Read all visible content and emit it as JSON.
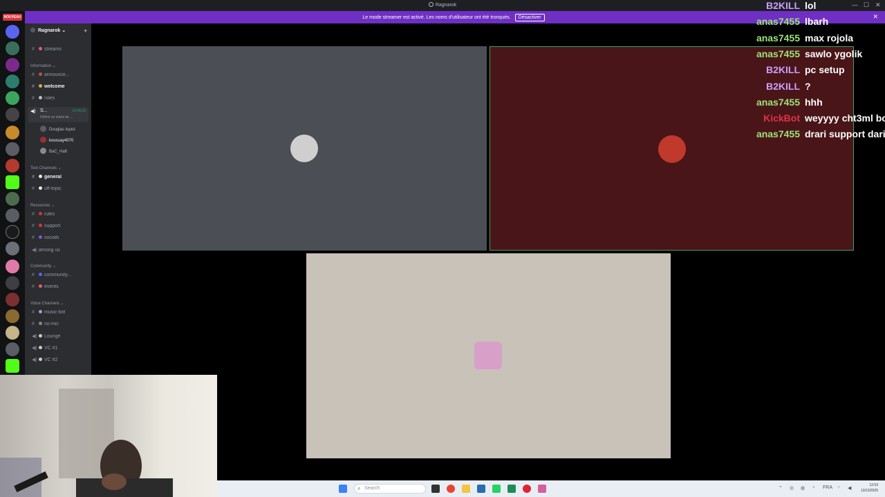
{
  "window": {
    "title": "Ragnarok",
    "controls": {
      "minimize": "—",
      "maximize": "☐",
      "close": "✕"
    }
  },
  "notice": {
    "message": "Le mode streamer est activé. Les noms d'utilisateur ont été tronqués.",
    "button": "Désactiver",
    "close": "✕"
  },
  "rail": {
    "badge": "NOUVEAU"
  },
  "server": {
    "name": "Ragnarok",
    "chevron": "⌄",
    "add_friend": "+"
  },
  "channels": {
    "streams": "streams",
    "cat_information": "Information ⌄",
    "announcements": "announce...",
    "welcome": "welcome",
    "roles": "roles",
    "live_channel": "S...",
    "live_time": "13:45:59",
    "live_sub": "Définir un statut de ...",
    "voice_users": [
      "Douglas lopez",
      "koussay4070",
      "BaC_Haft"
    ],
    "cat_text": "Text Channels ⌄",
    "general": "general",
    "off_topic": "off-topic",
    "cat_resources": "Resources ⌄",
    "rules": "rules",
    "support": "support",
    "socials": "socials",
    "among_us": "among us",
    "cat_community": "Community ⌄",
    "community": "community...",
    "events": "events",
    "cat_voice": "Voice Channels ⌄",
    "music_bot": "music-bot",
    "no_mic": "no-mic",
    "lounge": "Lounge",
    "vc1": "VC #1",
    "vc2": "VC #2"
  },
  "tiles": [
    {
      "bg": "#4b4e55",
      "avatar": "#cfcfcf"
    },
    {
      "bg": "#4a1518",
      "avatar": "#c0392b",
      "speaking_border": "#3ba55c"
    },
    {
      "bg": "#c8c2b8",
      "avatar": "#d8a0c8"
    }
  ],
  "chat": [
    {
      "user": "B2KILL",
      "text": "lol",
      "color": "#c9a0ff"
    },
    {
      "user": "anas7455",
      "text": "lbarh",
      "color": "#9be37a"
    },
    {
      "user": "anas7455",
      "text": "max rojola",
      "color": "#9be37a"
    },
    {
      "user": "anas7455",
      "text": "sawlo ygolik",
      "color": "#9be37a"
    },
    {
      "user": "B2KILL",
      "text": "pc setup",
      "color": "#c9a0ff"
    },
    {
      "user": "B2KILL",
      "text": "?",
      "color": "#c9a0ff"
    },
    {
      "user": "anas7455",
      "text": "hhh",
      "color": "#9be37a"
    },
    {
      "user": "KickBot",
      "text": "weyyyy cht3ml bo",
      "color": "#e0324a"
    },
    {
      "user": "anas7455",
      "text": "drari support dari",
      "color": "#9be37a"
    }
  ],
  "taskbar": {
    "search_placeholder": "Search",
    "clock_time": "12:53",
    "clock_date": "13/12/2025",
    "lang": "FRA"
  }
}
